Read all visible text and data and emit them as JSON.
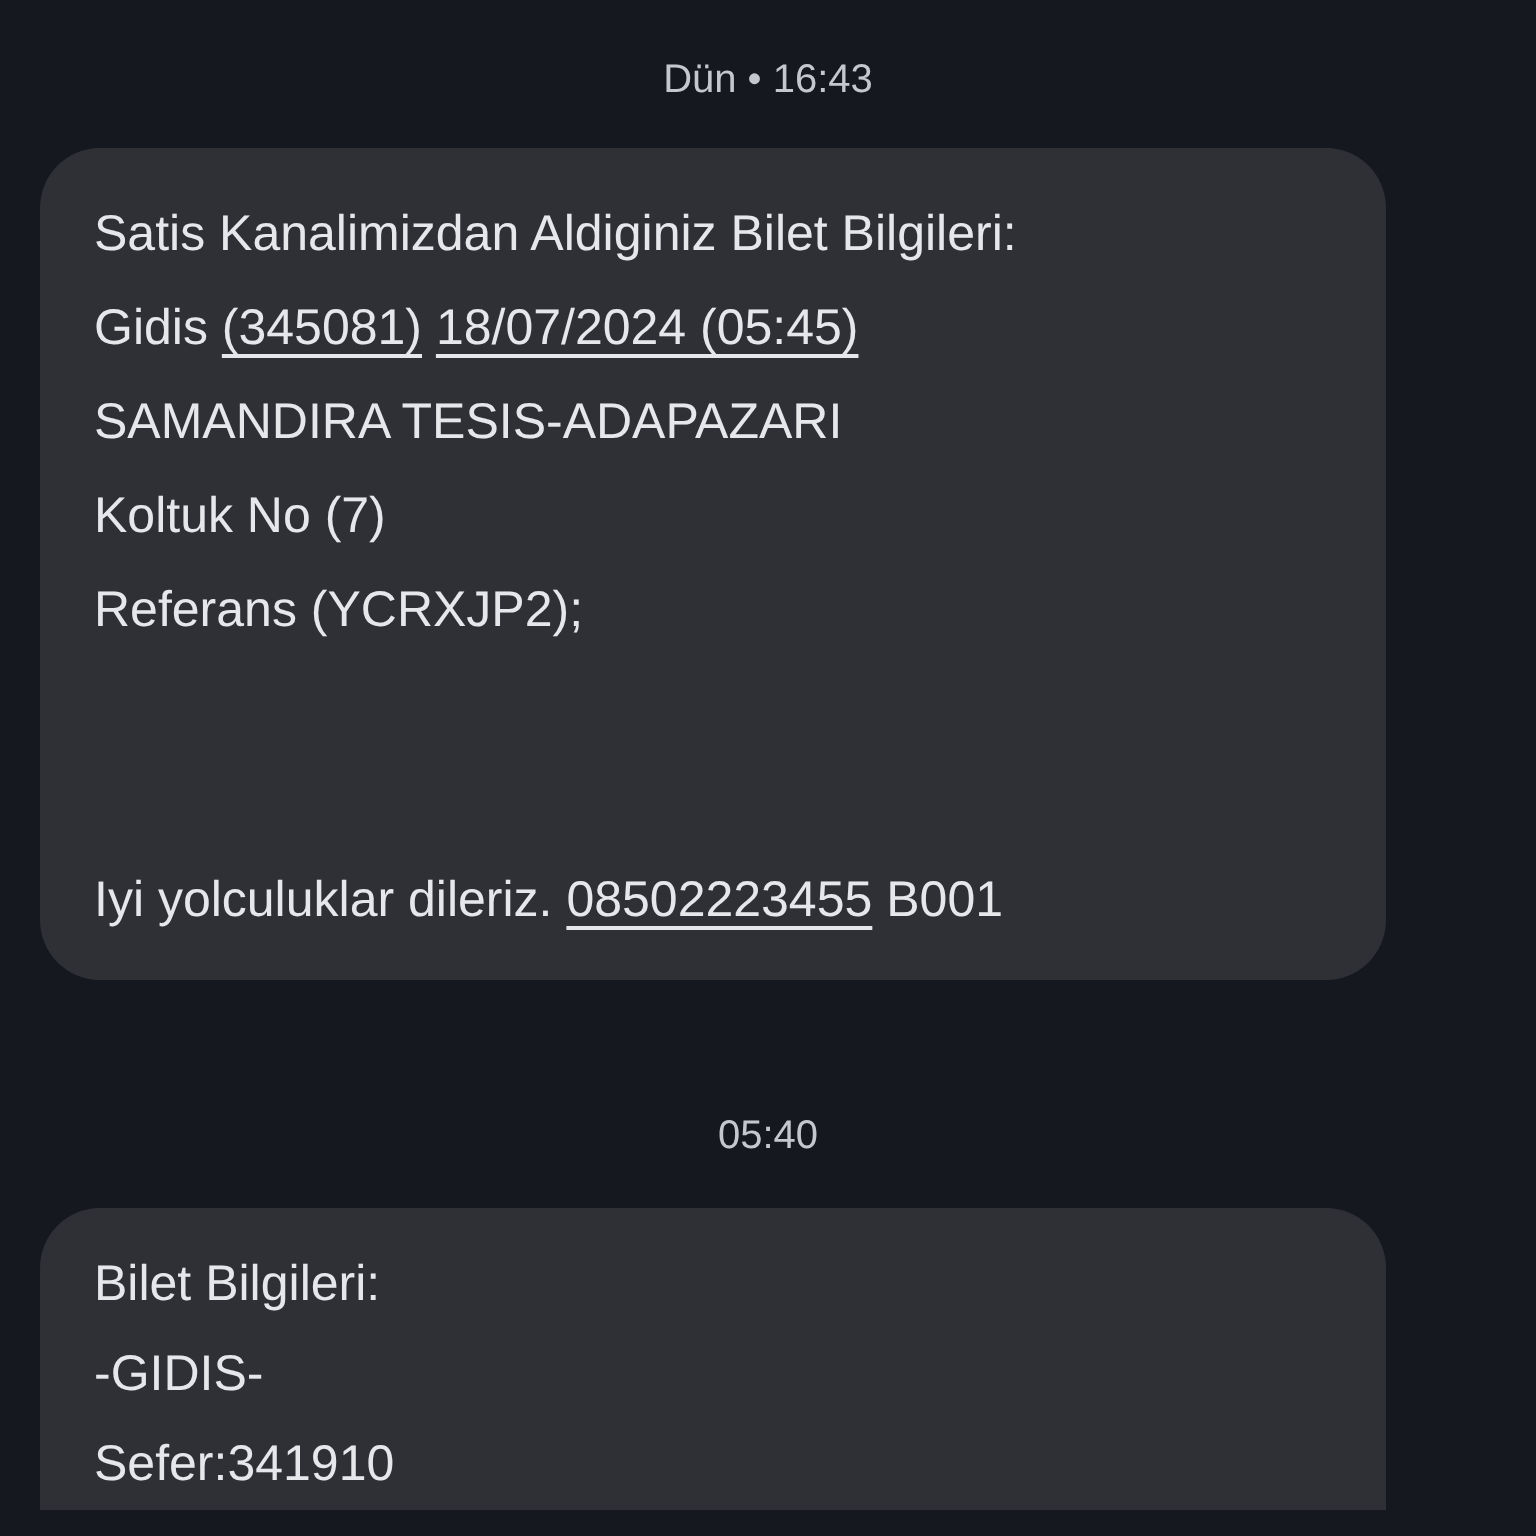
{
  "conversation": [
    {
      "timestamp": {
        "day": "Dün",
        "separator": "•",
        "time": "16:43"
      },
      "message": {
        "lines": [
          {
            "segments": [
              {
                "kind": "text",
                "text": "Satis Kanalimizdan Aldiginiz Bilet Bilgileri:"
              }
            ],
            "spaced": false
          },
          {
            "segments": [
              {
                "kind": "text",
                "text": "Gidis"
              },
              {
                "kind": "link",
                "text": "(345081)"
              },
              {
                "kind": "link",
                "text": "18/07/2024 (05:45)"
              }
            ],
            "spaced": false
          },
          {
            "segments": [
              {
                "kind": "text",
                "text": "SAMANDIRA TESIS-ADAPAZARI"
              }
            ],
            "spaced": false
          },
          {
            "segments": [
              {
                "kind": "text",
                "text": "Koltuk No (7)"
              }
            ],
            "spaced": false
          },
          {
            "segments": [
              {
                "kind": "text",
                "text": "Referans (YCRXJP2);"
              }
            ],
            "spaced": false
          },
          {
            "segments": [
              {
                "kind": "text",
                "text": "Iyi yolculuklar dileriz."
              },
              {
                "kind": "link",
                "text": "08502223455"
              },
              {
                "kind": "text",
                "text": "B001"
              }
            ],
            "spaced": true
          }
        ]
      }
    },
    {
      "timestamp": {
        "time": "05:40"
      },
      "message": {
        "lines": [
          {
            "segments": [
              {
                "kind": "text",
                "text": "Bilet Bilgileri:"
              }
            ],
            "spaced": false
          },
          {
            "segments": [
              {
                "kind": "text",
                "text": "-GIDIS-"
              }
            ],
            "spaced": false
          },
          {
            "segments": [
              {
                "kind": "text",
                "text": "Sefer:341910"
              }
            ],
            "spaced": false
          }
        ]
      }
    }
  ]
}
